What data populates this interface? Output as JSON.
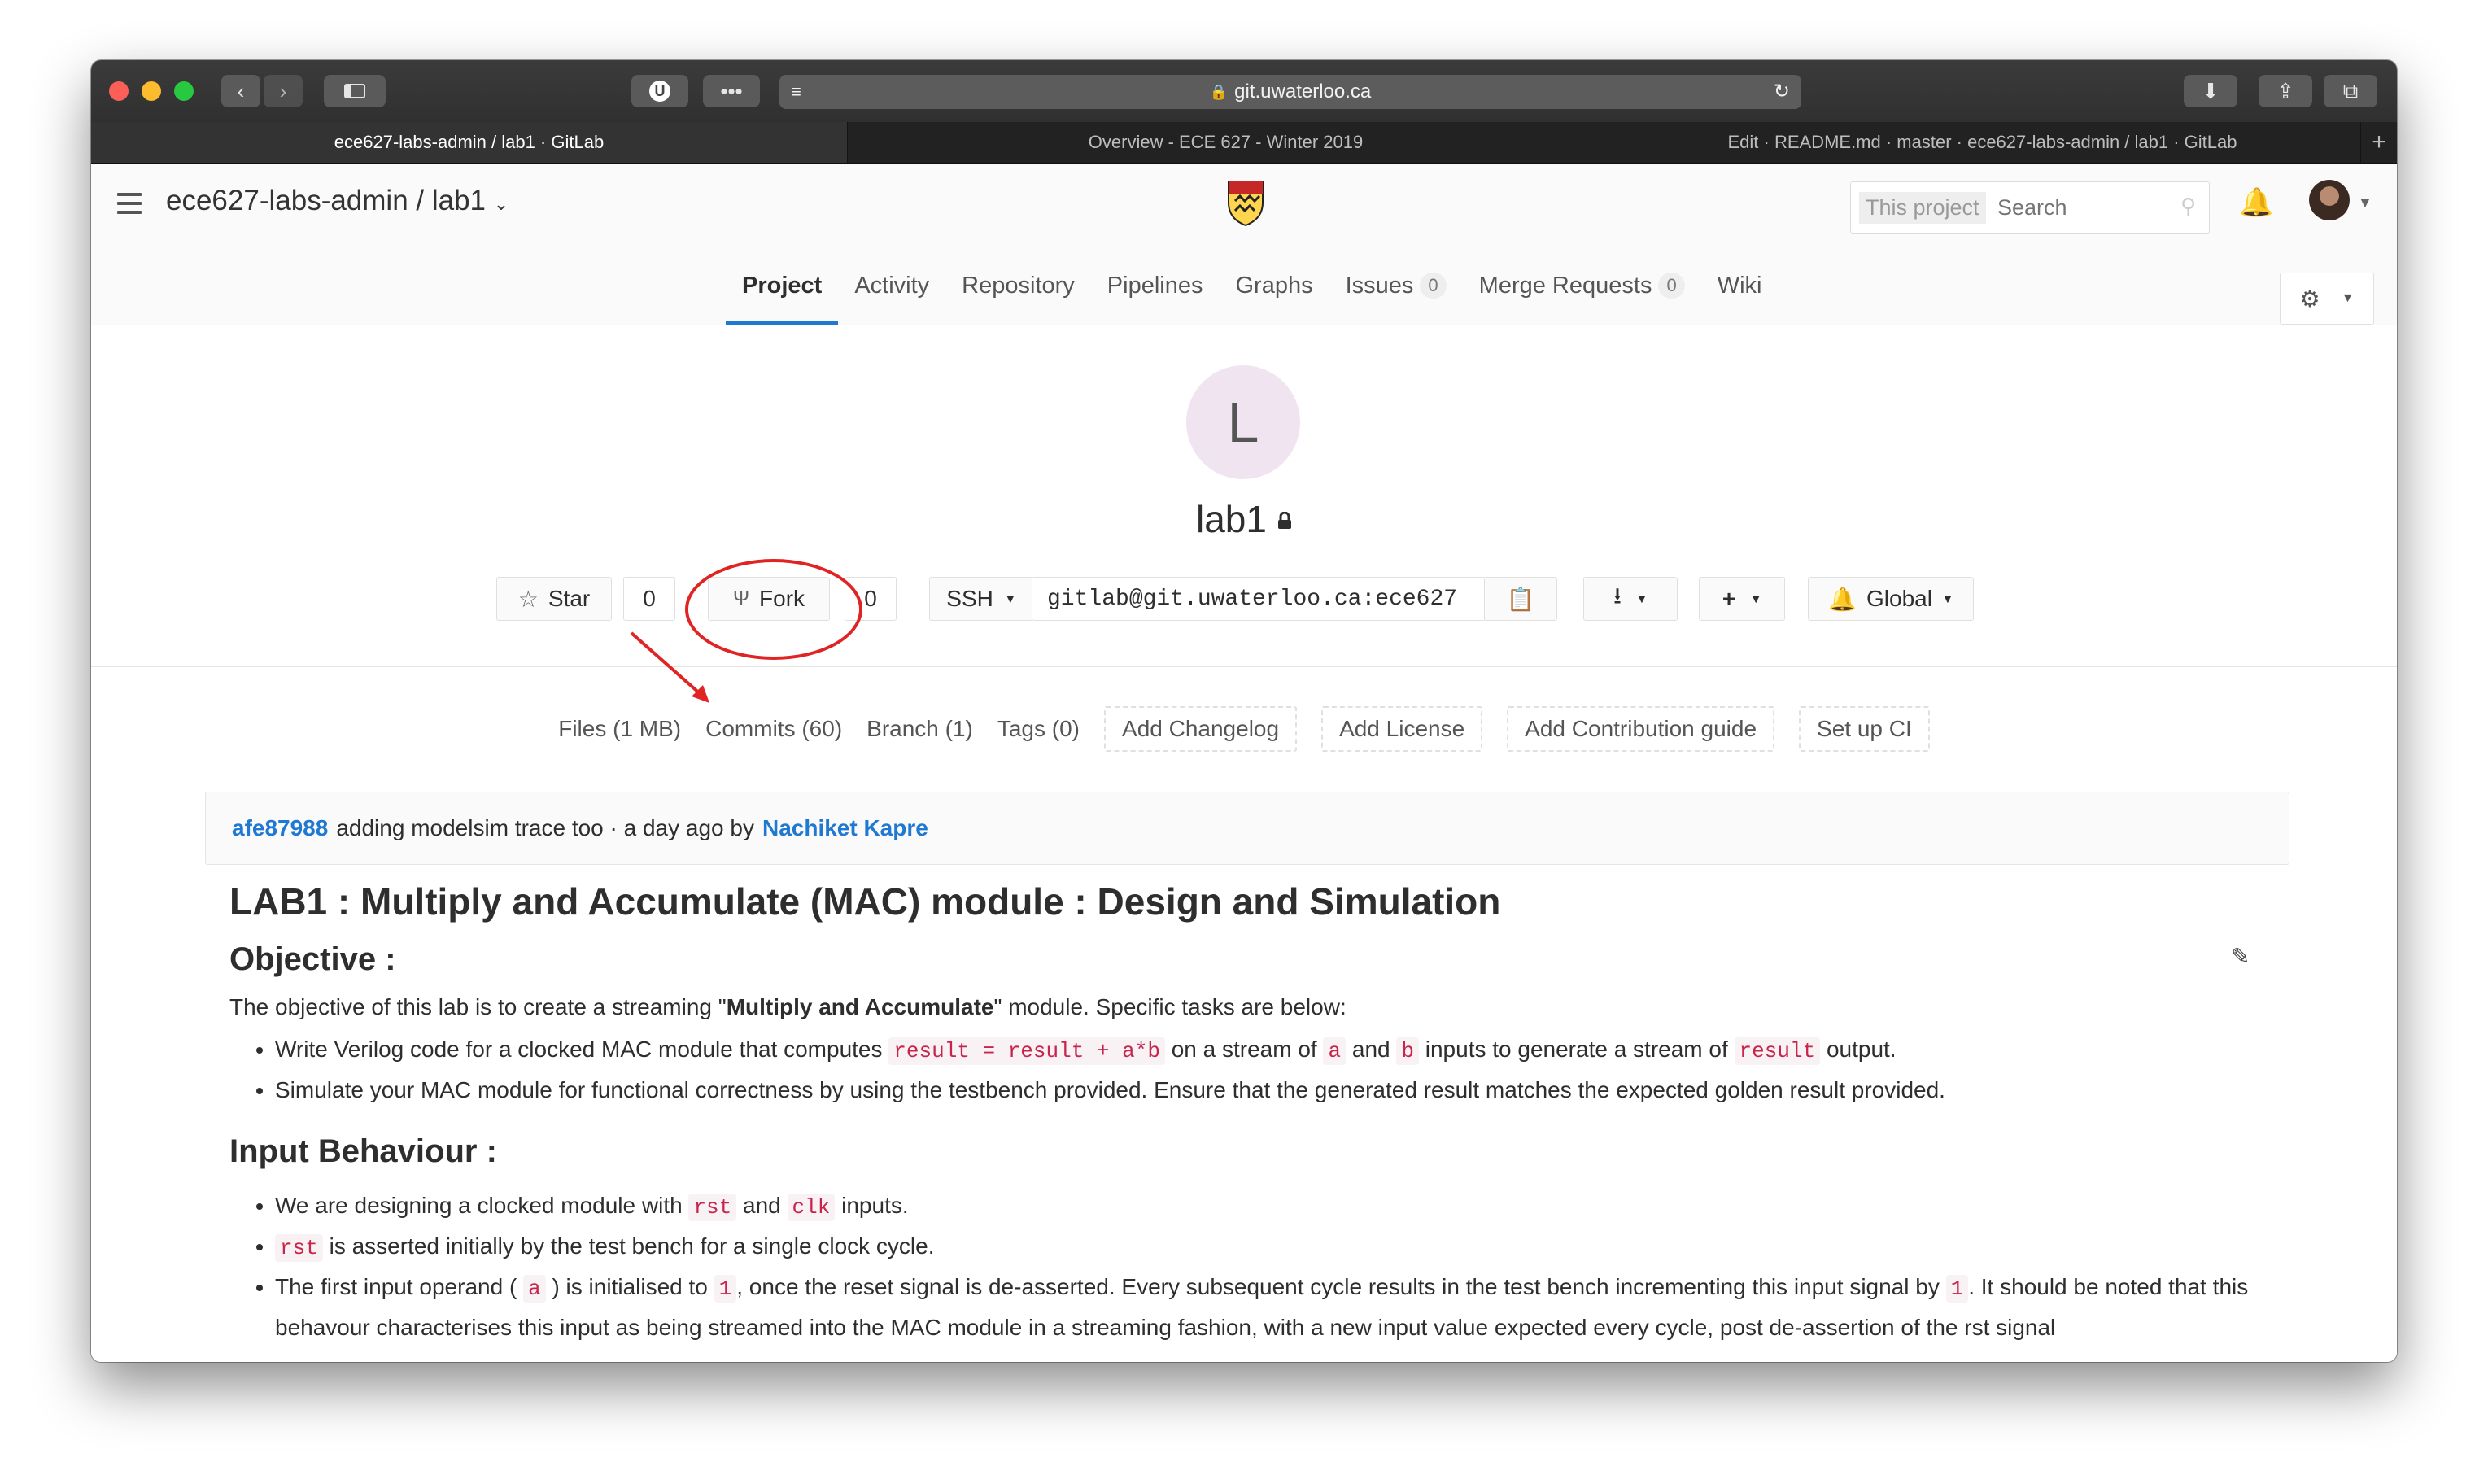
{
  "browser": {
    "address": "git.uwaterloo.ca",
    "tabs": [
      {
        "label": "ece627-labs-admin / lab1 · GitLab",
        "active": true
      },
      {
        "label": "Overview - ECE 627 - Winter 2019",
        "active": false
      },
      {
        "label": "Edit · README.md · master · ece627-labs-admin / lab1 · GitLab",
        "active": false
      }
    ],
    "new_tab": "+"
  },
  "header": {
    "project_path": "ece627-labs-admin / lab1",
    "search_scope": "This project",
    "search_placeholder": "Search"
  },
  "nav": {
    "items": [
      {
        "label": "Project",
        "active": true
      },
      {
        "label": "Activity"
      },
      {
        "label": "Repository"
      },
      {
        "label": "Pipelines"
      },
      {
        "label": "Graphs"
      },
      {
        "label": "Issues",
        "badge": "0"
      },
      {
        "label": "Merge Requests",
        "badge": "0"
      },
      {
        "label": "Wiki"
      }
    ]
  },
  "project": {
    "avatar_letter": "L",
    "name": "lab1",
    "star_label": "Star",
    "star_count": "0",
    "fork_label": "Fork",
    "fork_count": "0",
    "protocol": "SSH",
    "clone_url": "gitlab@git.uwaterloo.ca:ece627",
    "notification_label": "Global"
  },
  "stats": {
    "files": "Files (1 MB)",
    "commits": "Commits (60)",
    "branch": "Branch (1)",
    "tags": "Tags (0)",
    "add_changelog": "Add Changelog",
    "add_license": "Add License",
    "add_contribution": "Add Contribution guide",
    "setup_ci": "Set up CI"
  },
  "commit": {
    "sha": "afe87988",
    "message": "adding modelsim trace too · a day ago by",
    "author": "Nachiket Kapre"
  },
  "readme": {
    "title": "LAB1 : Multiply and Accumulate (MAC) module : Design and Simulation",
    "objective_heading": "Objective :",
    "objective_intro_a": "The objective of this lab is to create a streaming \"",
    "objective_intro_bold": "Multiply and Accumulate",
    "objective_intro_b": "\" module. Specific tasks are below:",
    "bullet1_a": "Write Verilog code for a clocked MAC module that computes",
    "bullet1_code1": "result = result + a*b",
    "bullet1_b": "on a stream of",
    "bullet1_code2": "a",
    "bullet1_c": "and",
    "bullet1_code3": "b",
    "bullet1_d": "inputs to generate a stream of",
    "bullet1_code4": "result",
    "bullet1_e": "output.",
    "bullet2": "Simulate your MAC module for functional correctness by using the testbench provided. Ensure that the generated result matches the expected golden result provided.",
    "input_heading": "Input Behaviour :",
    "ib1_a": "We are designing a clocked module with",
    "ib1_code1": "rst",
    "ib1_b": "and",
    "ib1_code2": "clk",
    "ib1_c": "inputs.",
    "ib2_code": "rst",
    "ib2_text": "is asserted initially by the test bench for a single clock cycle.",
    "ib3_a": "The first input operand (",
    "ib3_code1": "a",
    "ib3_b": ") is initialised to",
    "ib3_code2": "1",
    "ib3_c": ", once the reset signal is de-asserted. Every subsequent cycle results in the test bench incrementing this input signal by",
    "ib3_code3": "1",
    "ib3_d": ". It should be noted that this behavour characterises this input as being streamed into the MAC module in a streaming fashion, with a new input value expected every cycle, post de-assertion of the rst signal"
  }
}
